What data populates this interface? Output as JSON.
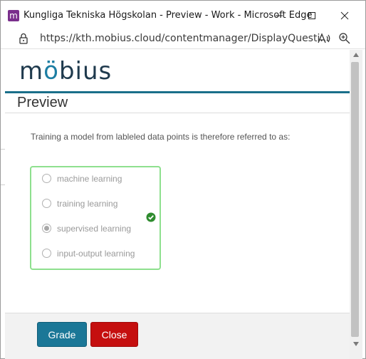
{
  "window": {
    "title": "Kungliga Tekniska Högskolan - Preview - Work - Microsoft Edge",
    "app_icon_letter": "m"
  },
  "address_bar": {
    "url": "https://kth.mobius.cloud/contentmanager/DisplayQuesti..."
  },
  "logo": {
    "prefix": "m",
    "accent": "ö",
    "suffix": "bius"
  },
  "page": {
    "title": "Preview"
  },
  "question": {
    "text": "Training a model from lableled data points is therefore referred to as:",
    "choices": [
      {
        "label": "machine learning",
        "selected": false
      },
      {
        "label": "training learning",
        "selected": false
      },
      {
        "label": "supervised learning",
        "selected": true
      },
      {
        "label": "input-output learning",
        "selected": false
      }
    ]
  },
  "footer": {
    "grade_label": "Grade",
    "close_label": "Close"
  },
  "colors": {
    "brand": "#1a6f8a",
    "grade_button": "#1b7797",
    "close_button": "#c50f0f",
    "correct_border": "#8ee08e",
    "correct_check": "#2e8b2e"
  },
  "icons": {
    "lock": "lock-icon",
    "read_aloud": "read-aloud-icon",
    "zoom": "zoom-icon",
    "check": "check-circle-icon"
  }
}
